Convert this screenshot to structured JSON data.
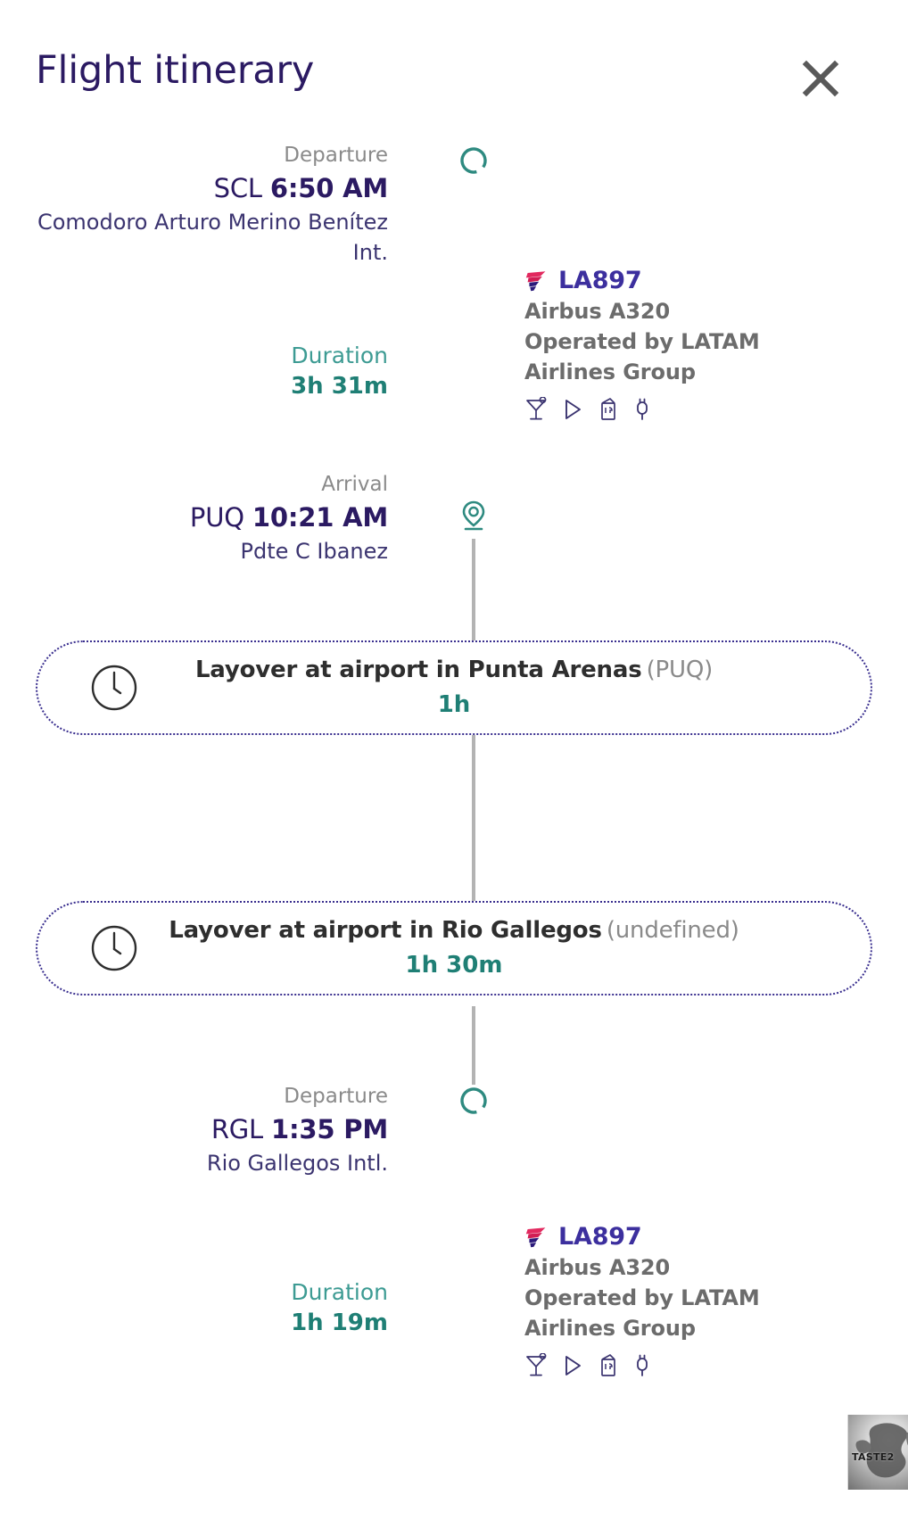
{
  "header": {
    "title": "Flight itinerary",
    "close_icon": "close-icon"
  },
  "segments": [
    {
      "departure": {
        "label": "Departure",
        "code": "SCL",
        "time": "6:50 AM",
        "airport": "Comodoro Arturo Merino Benítez Int.",
        "marker_icon": "circle-marker-icon"
      },
      "duration": {
        "label": "Duration",
        "value": "3h 31m"
      },
      "flight": {
        "number": "LA897",
        "aircraft": "Airbus A320",
        "operator_line_1": "Operated by LATAM",
        "operator_line_2": "Airlines Group",
        "logo_icon": "latam-logo-icon",
        "amenities": [
          "drink-icon",
          "entertainment-icon",
          "meal-icon",
          "power-outlet-icon"
        ]
      },
      "arrival": {
        "label": "Arrival",
        "code": "PUQ",
        "time": "10:21 AM",
        "airport": "Pdte C Ibanez",
        "marker_icon": "location-pin-icon"
      }
    },
    {
      "departure": {
        "label": "Departure",
        "code": "RGL",
        "time": "1:35 PM",
        "airport": "Rio Gallegos Intl.",
        "marker_icon": "circle-marker-icon"
      },
      "duration": {
        "label": "Duration",
        "value": "1h 19m"
      },
      "flight": {
        "number": "LA897",
        "aircraft": "Airbus A320",
        "operator_line_1": "Operated by LATAM",
        "operator_line_2": "Airlines Group",
        "logo_icon": "latam-logo-icon",
        "amenities": [
          "drink-icon",
          "entertainment-icon",
          "meal-icon",
          "power-outlet-icon"
        ]
      }
    }
  ],
  "layovers": [
    {
      "title": "Layover at airport in Punta Arenas",
      "code": "(PUQ)",
      "duration": "1h",
      "icon": "clock-icon"
    },
    {
      "title": "Layover at airport in Rio Gallegos",
      "code": "(undefined)",
      "duration": "1h 30m",
      "icon": "clock-icon"
    }
  ],
  "watermark": {
    "text": "TASTE2",
    "icon": "globe-icon"
  },
  "colors": {
    "title_navy": "#2b1a62",
    "teal": "#1f7f75",
    "teal_light": "#3d9b93",
    "muted_gray": "#8a8a8a",
    "flight_blue": "#3c2f9e",
    "dotted_border": "#3a2f8f",
    "rail_gray": "#b3b3b3"
  }
}
